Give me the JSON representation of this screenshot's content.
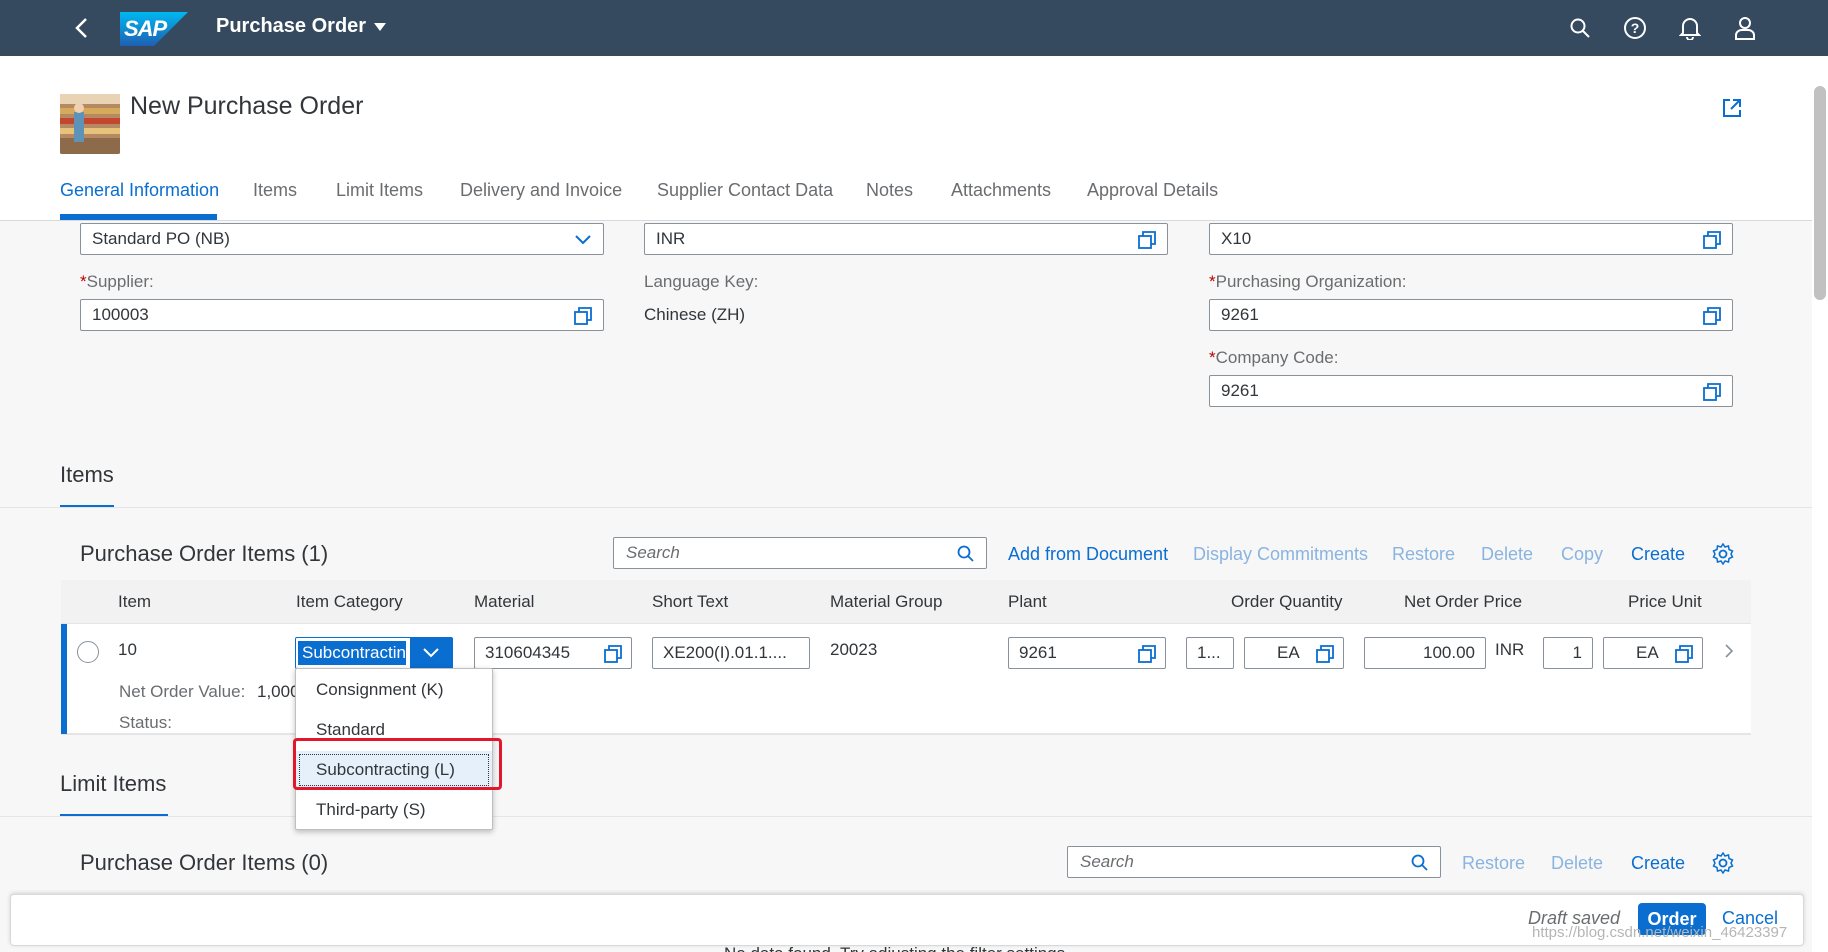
{
  "shell": {
    "logo_text": "SAP",
    "title": "Purchase Order",
    "brand_color": "#354a5f",
    "icons": [
      "back-icon",
      "search-icon",
      "help-icon",
      "notification-bell-icon",
      "user-icon"
    ]
  },
  "header": {
    "title": "New Purchase Order",
    "tabs": [
      "General Information",
      "Items",
      "Limit Items",
      "Delivery and Invoice",
      "Supplier Contact Data",
      "Notes",
      "Attachments",
      "Approval Details"
    ],
    "active_tab": "General Information"
  },
  "general": {
    "doc_type": "Standard PO (NB)",
    "currency": "INR",
    "purchasing_group": "X10",
    "supplier_label": "Supplier:",
    "supplier": "100003",
    "language_label": "Language Key:",
    "language": "Chinese (ZH)",
    "purch_org_label": "Purchasing Organization:",
    "purch_org": "9261",
    "company_code_label": "Company Code:",
    "company_code": "9261",
    "required_mark": "*"
  },
  "items_section": {
    "title": "Items",
    "table_title": "Purchase Order Items (1)",
    "search_placeholder": "Search",
    "actions": {
      "add_from_document": "Add from Document",
      "display_commitments": "Display Commitments",
      "restore": "Restore",
      "delete": "Delete",
      "copy": "Copy",
      "create": "Create"
    },
    "columns": [
      "Item",
      "Item Category",
      "Material",
      "Short Text",
      "Material Group",
      "Plant",
      "Order Quantity",
      "Net Order Price",
      "Price Unit"
    ],
    "row": {
      "item": "10",
      "item_category": "Subcontractin",
      "material": "310604345",
      "short_text": "XE200(I).01.1....",
      "material_group": "20023",
      "plant": "9261",
      "order_qty": "1...",
      "order_unit": "EA",
      "net_price": "100.00",
      "currency": "INR",
      "price_unit": "1",
      "price_uom": "EA",
      "net_order_value_label": "Net Order Value:",
      "net_order_value": "1,000",
      "status_label": "Status:"
    },
    "dropdown_options": [
      "Consignment (K)",
      "Standard",
      "Subcontracting (L)",
      "Third-party (S)"
    ],
    "selected_option": "Subcontracting (L)"
  },
  "limit_items_section": {
    "title": "Limit Items",
    "table_title": "Purchase Order Items (0)",
    "search_placeholder": "Search",
    "actions": {
      "restore": "Restore",
      "delete": "Delete",
      "create": "Create"
    },
    "no_data": "No data found. Try adjusting the filter settings."
  },
  "footer": {
    "draft_status": "Draft saved",
    "order_label": "Order",
    "cancel_label": "Cancel"
  },
  "watermark": "https://blog.csdn.net/weixin_46423397"
}
